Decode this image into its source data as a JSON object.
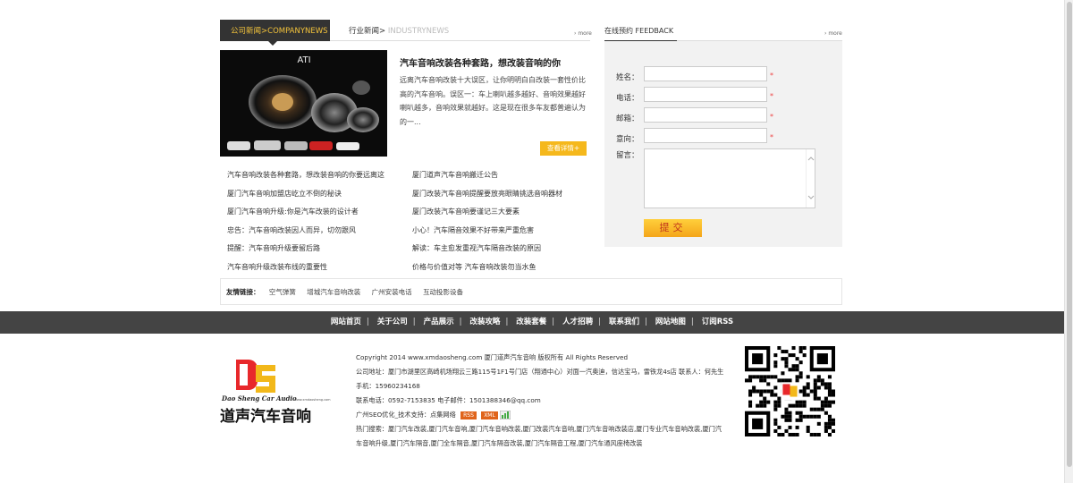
{
  "news": {
    "tab_active_cn": "公司新闻",
    "tab_active_sep": ">",
    "tab_active_en": "COMPANYNEWS",
    "tab2_cn": "行业新闻",
    "tab2_sep": ">",
    "tab2_en": "INDUSTRYNEWS",
    "more_label": "more",
    "photo_text": "ATI",
    "headline": "汽车音响改装各种套路，想改装音响的你",
    "summary": "远离汽车音响改装十大误区，让你明明白白改装一套性价比高的汽车音响。误区一：车上喇叭越多越好、音响效果越好喇叭越多，音响效果就越好。这是现在很多车友都普遍认为的一...",
    "detail_button": "查看详情+",
    "list_left": [
      "汽车音响改装各种套路，想改装音响的你要远离这",
      "厦门汽车音响加盟店屹立不倒的秘诀",
      "厦门汽车音响升级:你是汽车改装的设计者",
      "忠告：汽车音响改装因人而异，切勿跟风",
      "提醒：汽车音响升级要留后路",
      "汽车音响升级改装布线的重要性"
    ],
    "list_right": [
      "厦门道声汽车音响搬迁公告",
      "厦门改装汽车音响提醒要放亮眼睛挑选音响器材",
      "厦门改装汽车音响要谨记三大要素",
      "小心！汽车隔音效果不好带来严重危害",
      "解读：车主愈发重视汽车隔音改装的原因",
      "价格与价值对等 汽车音响改装勿当水鱼"
    ]
  },
  "links": {
    "label": "友情链接：",
    "items": [
      "空气弹簧",
      "增城汽车音响改装",
      "广州安装电话",
      "互动投影设备"
    ]
  },
  "feedback": {
    "title": "在线预约 FEEDBACK",
    "more_label": "more",
    "fields": [
      "姓名：",
      "电话：",
      "邮箱：",
      "意向："
    ],
    "required_mark": "*",
    "message_label": "留言：",
    "submit_label": "提交"
  },
  "nav": {
    "items": [
      "网站首页",
      "关于公司",
      "产品展示",
      "改装攻略",
      "改装套餐",
      "人才招聘",
      "联系我们",
      "网站地图",
      "订阅RSS"
    ],
    "separator": "|"
  },
  "footer": {
    "logo_en": "Dao Sheng Car Audio",
    "logo_small": "www.xmdaosheng.com",
    "logo_cn": "道声汽车音响",
    "copyright": "Copyright 2014 www.xmdaosheng.com 厦门道声汽车音响 版权所有 All Rights Reserved",
    "address": "公司地址：厦门市湖里区高崎机场翔云三路115号1F1号门店（翔通中心）对面一汽奥迪，信达宝马，雷铁龙4s店   联系人：何先生   手机：15960234168",
    "phone": "联系电话：0592-7153835   电子邮件：1501388346@qq.com",
    "seo": "广州SEO优化_技术支持：点集网络",
    "badge_rss": "RSS",
    "badge_xml": "XML",
    "hot": "热门搜索：厦门汽车改装,厦门汽车音响,厦门汽车音响改装,厦门改装汽车音响,厦门汽车音响改装店,厦门专业汽车音响改装,厦门汽车音响升级,厦门汽车隔音,厦门全车隔音,厦门汽车隔音改装,厦门汽车隔音工程,厦门汽车通风座椅改装"
  },
  "colors": {
    "nav_bg": "#444444",
    "accent_yellow": "#f5b81c",
    "tab_text": "#f3c33b",
    "required": "#ee4444"
  }
}
